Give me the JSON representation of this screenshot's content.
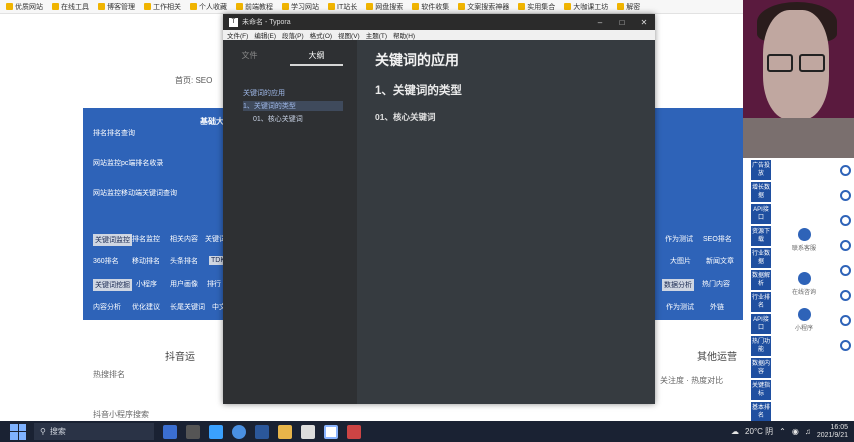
{
  "bookmarks": [
    "优质网站",
    "在线工具",
    "博客管理",
    "工作相关",
    "个人收藏",
    "前端教程",
    "学习网站",
    "IT站长",
    "网盘搜索",
    "软件收集",
    "文案搜索神器",
    "实用集合",
    "大咖课工坊",
    "解密"
  ],
  "background": {
    "breadcrumb": "首页: SEO",
    "panel_title": "基础大",
    "panel_lines": [
      "排名排名查询",
      "网站监控pc端排名收录",
      "网站监控移动端关键词查询"
    ],
    "pills_row1": [
      "关键词监控",
      "排名监控",
      "相关内容",
      "关键词",
      "作为测试",
      "SEO排名"
    ],
    "pills_row2": [
      "360排名",
      "移动排名",
      "头条排名",
      "TDK",
      "大图片",
      "新闻文章"
    ],
    "pills_row3": [
      "关键词挖掘",
      "小程序",
      "用户画像",
      "排行",
      "数据分析",
      "热门内容"
    ],
    "pills_row4": [
      "内容分析",
      "优化建议",
      "长尾关键词",
      "中文",
      "作为测试",
      "外链"
    ],
    "section_left": "抖音运",
    "section_right": "其他运营",
    "left_small_1": "热搜排名",
    "left_small_2": "抖音小程序搜索",
    "right_small": "关注度 · 热度对比",
    "right_badges": [
      "广告投放",
      "增长数据",
      "API接口",
      "资源下载",
      "行业数据",
      "数据解析",
      "行业排名",
      "API接口",
      "热门功能",
      "数据内容",
      "关键指标",
      "基本排名"
    ],
    "side_tools": [
      "联系客服",
      "在线咨询",
      "小程序"
    ]
  },
  "typora": {
    "title": "未命名 - Typora",
    "menu": [
      "文件(F)",
      "编辑(E)",
      "段落(P)",
      "格式(O)",
      "视图(V)",
      "主题(T)",
      "帮助(H)"
    ],
    "tabs": {
      "files": "文件",
      "outline": "大纲"
    },
    "outline": [
      "关键词的应用",
      "1、关键词的类型",
      "01、核心关键词"
    ],
    "doc": {
      "h1": "关键词的应用",
      "h2": "1、关键词的类型",
      "h3": "01、核心关键词"
    }
  },
  "taskbar": {
    "search_placeholder": "搜索",
    "weather": "20°C 阴",
    "time": "16:05",
    "date": "2021/9/21"
  }
}
